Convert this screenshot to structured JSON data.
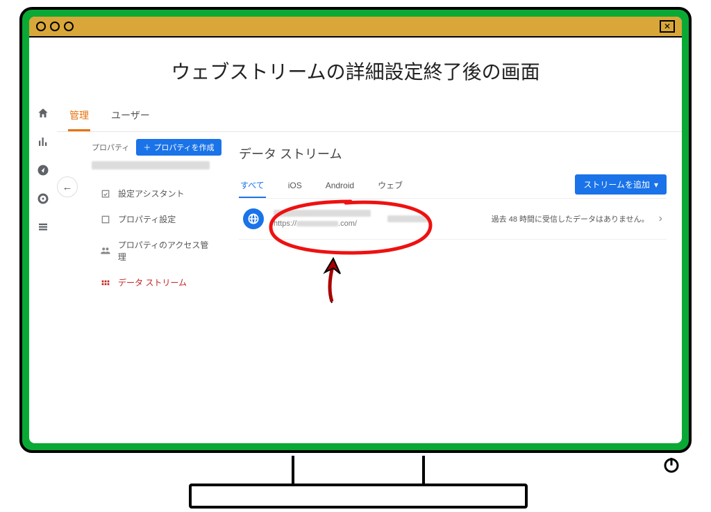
{
  "page_title": "ウェブストリームの詳細設定終了後の画面",
  "tabs": {
    "admin": "管理",
    "user": "ユーザー"
  },
  "property": {
    "label": "プロパティ",
    "create_button": "プロパティを作成"
  },
  "menu": {
    "setup_assistant": "設定アシスタント",
    "property_settings": "プロパティ設定",
    "access_management": "プロパティのアクセス管理",
    "data_streams": "データ ストリーム"
  },
  "content": {
    "heading": "データ ストリーム",
    "stream_tabs": {
      "all": "すべて",
      "ios": "iOS",
      "android": "Android",
      "web": "ウェブ"
    },
    "add_stream_button": "ストリームを追加",
    "stream_row": {
      "url_prefix": "https://",
      "url_suffix": ".com/",
      "status": "過去 48 時間に受信したデータはありません。"
    }
  }
}
